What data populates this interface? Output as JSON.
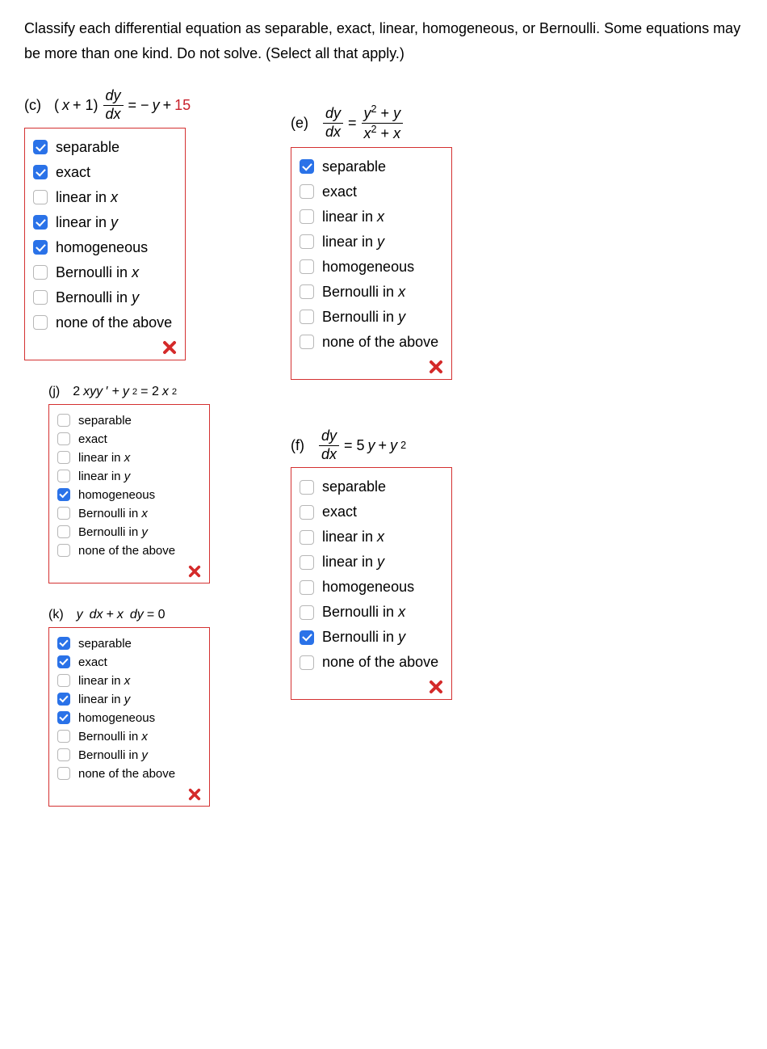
{
  "instructions": "Classify each differential equation as separable, exact, linear, homogeneous, or Bernoulli. Some equations may be more than one kind. Do not solve. (Select all that apply.)",
  "options": {
    "separable": "separable",
    "exact": "exact",
    "linear_in_x": "linear in ",
    "linear_in_x_var": "x",
    "linear_in_y": "linear in ",
    "linear_in_y_var": "y",
    "homogeneous": "homogeneous",
    "bernoulli_in_x": "Bernoulli in ",
    "bernoulli_in_x_var": "x",
    "bernoulli_in_y": "Bernoulli in ",
    "bernoulli_in_y_var": "y",
    "none": "none of the above"
  },
  "questions": {
    "c": {
      "label": "(c)",
      "checked": [
        "separable",
        "exact",
        "linear_in_y",
        "homogeneous"
      ],
      "wrong": true,
      "display": {
        "lhs_pre": "(x + 1)",
        "frac_num": "dy",
        "frac_den": "dx",
        "eqtxt": " = −y + ",
        "const": "15"
      }
    },
    "j": {
      "label": "(j)",
      "checked": [
        "homogeneous"
      ],
      "wrong": true,
      "display": {
        "eq": "2xyy′ + y² = 2x²"
      }
    },
    "k": {
      "label": "(k)",
      "checked": [
        "separable",
        "exact",
        "linear_in_y",
        "homogeneous"
      ],
      "wrong": true,
      "display": {
        "eq": "y dx + x dy = 0"
      }
    },
    "e": {
      "label": "(e)",
      "checked": [
        "separable"
      ],
      "wrong": true,
      "display": {
        "frac1_num": "dy",
        "frac1_den": "dx",
        "eqtxt": " = ",
        "frac2_num": "y² + y",
        "frac2_den": "x² + x"
      }
    },
    "f": {
      "label": "(f)",
      "checked": [
        "bernoulli_in_y"
      ],
      "wrong": true,
      "display": {
        "frac_num": "dy",
        "frac_den": "dx",
        "eqtxt": " = 5y + y²"
      }
    }
  }
}
